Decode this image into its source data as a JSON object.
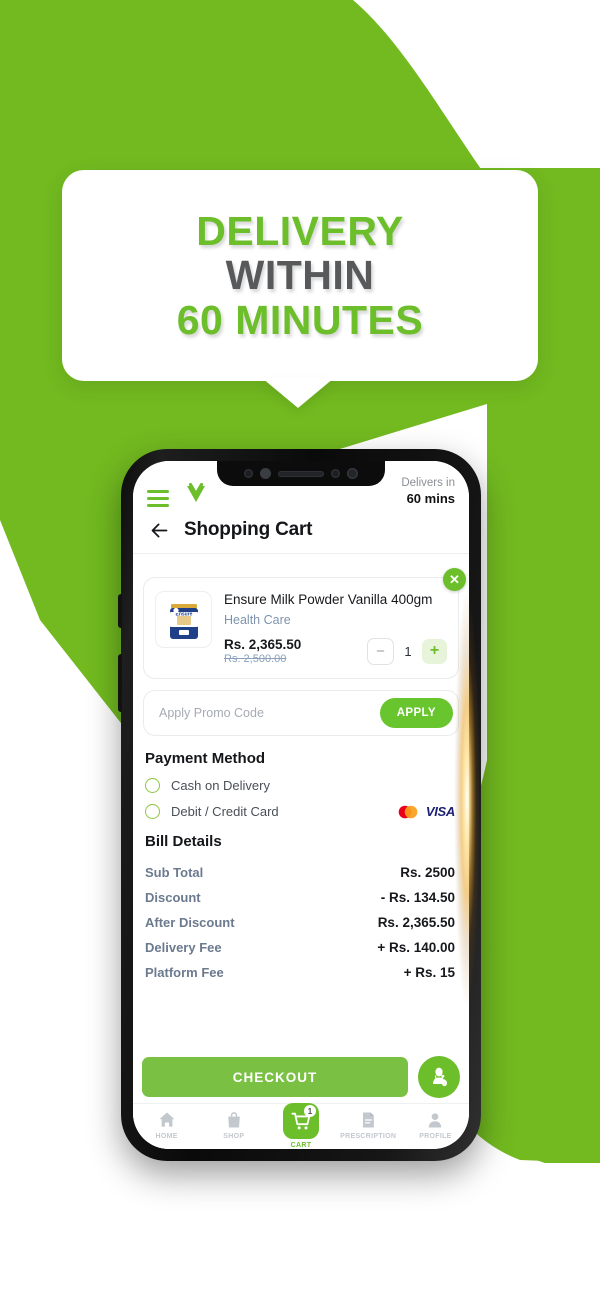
{
  "promo_banner": {
    "line1": "DELIVERY",
    "line2": "WITHIN",
    "line3": "60 MINUTES",
    "accent_color": "#6cbe2b",
    "neutral_color": "#58595b"
  },
  "background": {
    "green": "#72ba20"
  },
  "app": {
    "header": {
      "menu_icon": "hamburger-icon",
      "logo_icon": "brand-v-logo-icon",
      "delivery_label": "Delivers in",
      "delivery_value": "60 mins"
    },
    "title_bar": {
      "back_icon": "back-arrow-icon",
      "title": "Shopping Cart"
    },
    "cart_item": {
      "remove_label": "✕",
      "thumb_icon": "product-image-ensure-tin",
      "name": "Ensure Milk Powder Vanilla 400gm",
      "category": "Health Care",
      "price_current": "Rs. 2,365.50",
      "price_original": "Rs. 2,500.00",
      "qty_decrement": "−",
      "qty_value": "1",
      "qty_increment": "+"
    },
    "promo": {
      "placeholder": "Apply Promo Code",
      "value": "",
      "apply_label": "APPLY",
      "apply_color": "#68c52e"
    },
    "payment": {
      "heading": "Payment Method",
      "options": [
        {
          "label": "Cash on Delivery",
          "selected": false
        },
        {
          "label": "Debit / Credit Card",
          "selected": false
        }
      ],
      "card_logos": [
        "mastercard-icon",
        "visa-icon"
      ],
      "visa_text": "VISA"
    },
    "bill": {
      "heading": "Bill Details",
      "rows": [
        {
          "label": "Sub Total",
          "value": "Rs. 2500"
        },
        {
          "label": "Discount",
          "value": "- Rs. 134.50"
        },
        {
          "label": "After Discount",
          "value": "Rs. 2,365.50"
        },
        {
          "label": "Delivery Fee",
          "value": "+ Rs. 140.00"
        },
        {
          "label": "Platform Fee",
          "value": "+ Rs. 15"
        }
      ]
    },
    "checkout": {
      "label": "CHECKOUT",
      "color": "#7ac143",
      "support_icon": "support-agent-call-icon"
    },
    "bottom_nav": {
      "items": [
        {
          "label": "HOME",
          "icon": "home-icon",
          "active": false
        },
        {
          "label": "SHOP",
          "icon": "shopping-bag-icon",
          "active": false
        },
        {
          "label": "CART",
          "icon": "cart-icon",
          "active": true,
          "badge": "1"
        },
        {
          "label": "PRESCRIPTION",
          "icon": "prescription-document-icon",
          "active": false
        },
        {
          "label": "PROFILE",
          "icon": "person-icon",
          "active": false
        }
      ]
    }
  }
}
